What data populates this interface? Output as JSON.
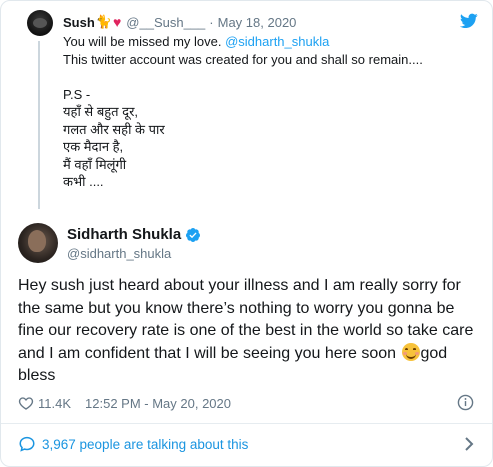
{
  "quoted_tweet": {
    "name": "Sush",
    "name_emoji": "🐈",
    "name_heart": "♥",
    "handle": "@__Sush___",
    "separator": "·",
    "date": "May 18, 2020",
    "lines": [
      {
        "text": "You will be missed my love. ",
        "mention": "@sidharth_shukla"
      },
      {
        "text": "This twitter account was created for you and shall so remain....",
        "mention": ""
      },
      {
        "text": "",
        "mention": ""
      },
      {
        "text": "P.S -",
        "mention": ""
      },
      {
        "text": "यहाँ से बहुत दूर,",
        "mention": ""
      },
      {
        "text": "गलत और सही के पार",
        "mention": ""
      },
      {
        "text": "एक मैदान है,",
        "mention": ""
      },
      {
        "text": "मैं वहाँ मिलूंगी",
        "mention": ""
      },
      {
        "text": "कभी ....",
        "mention": ""
      }
    ]
  },
  "main_tweet": {
    "name": "Sidharth Shukla",
    "handle": "@sidharth_shukla",
    "text_lines": [
      "Hey sush just heard about your illness and I am really sorry for",
      "the same but you know there’s nothing to worry you gonna be",
      "fine our recovery rate is one of the best in the world so take care",
      "and I am confident that I will be seeing you here soon "
    ],
    "text_end": "god",
    "text_last_line": "bless",
    "like_count": "11.4K",
    "time": "12:52 PM - May 20, 2020"
  },
  "footer": {
    "talking_label": "3,967 people are talking about this"
  },
  "colors": {
    "accent": "#1da1f2",
    "link": "#1b95e0",
    "muted": "#657786",
    "heart": "#e0245e"
  },
  "icons": {
    "logo": "twitter-logo-icon",
    "verified": "verified-badge-icon",
    "like": "heart-outline-icon",
    "info": "info-icon",
    "conversation": "speech-bubble-icon",
    "chevron": "chevron-right-icon"
  }
}
